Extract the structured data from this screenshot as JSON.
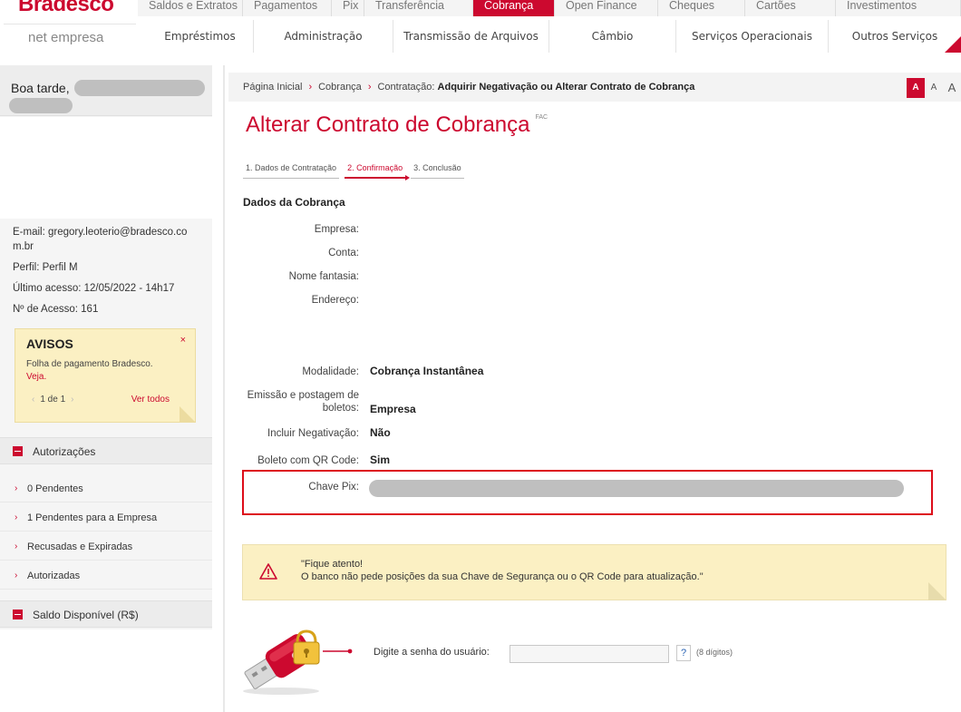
{
  "brand": {
    "logo": "Bradesco",
    "sub": "net empresa"
  },
  "nav_top": [
    {
      "label": "Saldos e Extratos"
    },
    {
      "label": "Pagamentos"
    },
    {
      "label": "Pix"
    },
    {
      "label": "Transferência"
    },
    {
      "label": "Cobrança"
    },
    {
      "label": "Open Finance"
    },
    {
      "label": "Cheques"
    },
    {
      "label": "Cartões"
    },
    {
      "label": "Investimentos"
    }
  ],
  "nav_sub": [
    {
      "label": "Empréstimos"
    },
    {
      "label": "Administração"
    },
    {
      "label": "Transmissão de Arquivos"
    },
    {
      "label": "Câmbio"
    },
    {
      "label": "Serviços Operacionais"
    },
    {
      "label": "Outros Serviços"
    }
  ],
  "sidebar": {
    "greeting": "Boa tarde,",
    "email": "E-mail: gregory.leoterio@bradesco.co m.br",
    "profile": "Perfil: Perfil M",
    "last_access": "Último acesso: 12/05/2022 - 14h17",
    "access_count": "Nº de Acesso: 161",
    "avisos": {
      "title": "AVISOS",
      "close": "×",
      "text": "Folha de pagamento Bradesco.",
      "link": "Veja.",
      "pager": "1 de 1",
      "see_all": "Ver todos"
    },
    "section_autorizacoes": "Autorizações",
    "links": [
      {
        "label": "0 Pendentes"
      },
      {
        "label": "1 Pendentes para a Empresa"
      },
      {
        "label": "Recusadas e Expiradas"
      },
      {
        "label": "Autorizadas"
      }
    ],
    "section_saldo": "Saldo Disponível (R$)"
  },
  "breadcrumb": {
    "home": "Página Inicial",
    "cobranca": "Cobrança",
    "current_prefix": "Contratação:",
    "current": "Adquirir Negativação ou Alterar Contrato de Cobrança"
  },
  "font_controls": [
    "A",
    "A",
    "A"
  ],
  "page": {
    "title": "Alterar Contrato de Cobrança",
    "title_tag": "FAC",
    "steps": [
      "1. Dados de Contratação",
      "2. Confirmação",
      "3. Conclusão"
    ],
    "section": "Dados da Cobrança",
    "fields": {
      "empresa": "Empresa:",
      "conta": "Conta:",
      "nome_fantasia": "Nome fantasia:",
      "endereco": "Endereço:",
      "modalidade_label": "Modalidade:",
      "modalidade_value": "Cobrança Instantânea",
      "emissao_label": "Emissão e postagem de boletos:",
      "emissao_value": "Empresa",
      "negativacao_label": "Incluir Negativação:",
      "negativacao_value": "Não",
      "qrcode_label": "Boleto com QR Code:",
      "qrcode_value": "Sim",
      "chave_pix_label": "Chave Pix:"
    }
  },
  "warning": {
    "line1": "\"Fique atento!",
    "line2": "O banco não pede posições da sua Chave de Segurança ou o QR Code para atualização.\""
  },
  "password": {
    "label": "Digite a senha do usuário:",
    "value": "",
    "help": "?",
    "hint": "(8 dígitos)"
  },
  "colors": {
    "brand_red": "#cc092f",
    "notice_yellow": "#fbf0c3",
    "highlight_border": "#dd0d1a"
  }
}
